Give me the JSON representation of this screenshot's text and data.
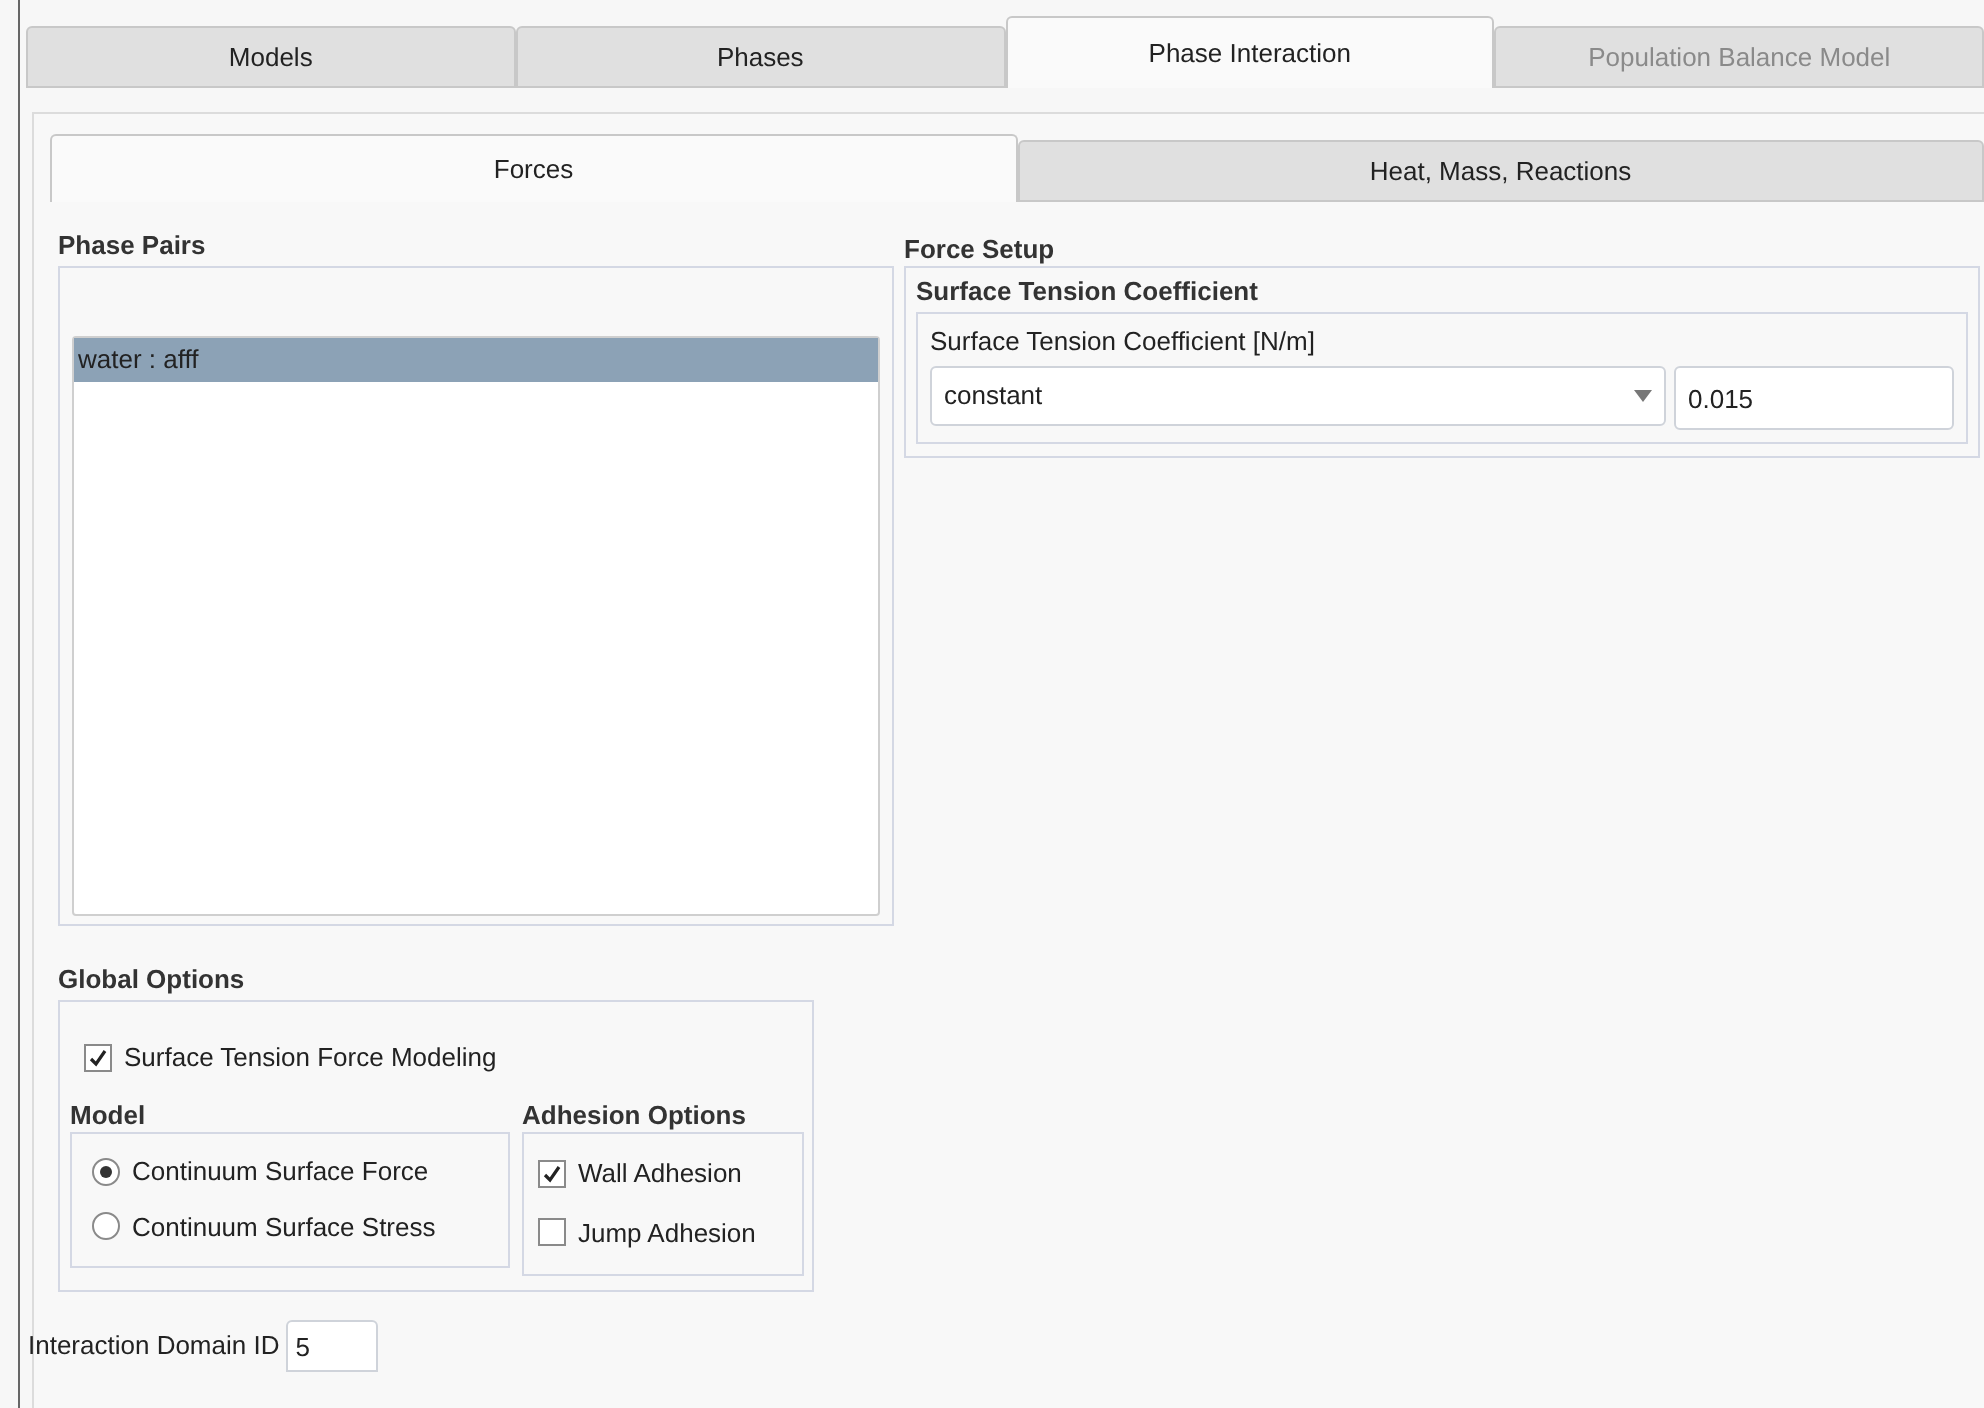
{
  "main_tabs": [
    {
      "label": "Models",
      "selected": false,
      "disabled": false
    },
    {
      "label": "Phases",
      "selected": false,
      "disabled": false
    },
    {
      "label": "Phase Interaction",
      "selected": true,
      "disabled": false
    },
    {
      "label": "Population Balance Model",
      "selected": false,
      "disabled": true
    }
  ],
  "sub_tabs": [
    {
      "label": "Forces",
      "selected": true
    },
    {
      "label": "Heat, Mass, Reactions",
      "selected": false
    }
  ],
  "phase_pairs": {
    "title": "Phase Pairs",
    "items": [
      {
        "label": "water : afff",
        "selected": true
      }
    ]
  },
  "force_setup": {
    "title": "Force Setup",
    "group_title": "Surface Tension Coefficient",
    "field_label": "Surface Tension Coefficient [N/m]",
    "method": "constant",
    "value": "0.015"
  },
  "global_options": {
    "title": "Global Options",
    "modeling": {
      "label": "Surface Tension Force Modeling",
      "checked": true
    },
    "model": {
      "title": "Model",
      "options": [
        {
          "label": "Continuum Surface Force",
          "selected": true
        },
        {
          "label": "Continuum Surface Stress",
          "selected": false
        }
      ]
    },
    "adhesion": {
      "title": "Adhesion Options",
      "options": [
        {
          "label": "Wall Adhesion",
          "checked": true
        },
        {
          "label": "Jump Adhesion",
          "checked": false
        }
      ]
    }
  },
  "interaction_domain": {
    "label": "Interaction Domain ID",
    "value": "5"
  }
}
